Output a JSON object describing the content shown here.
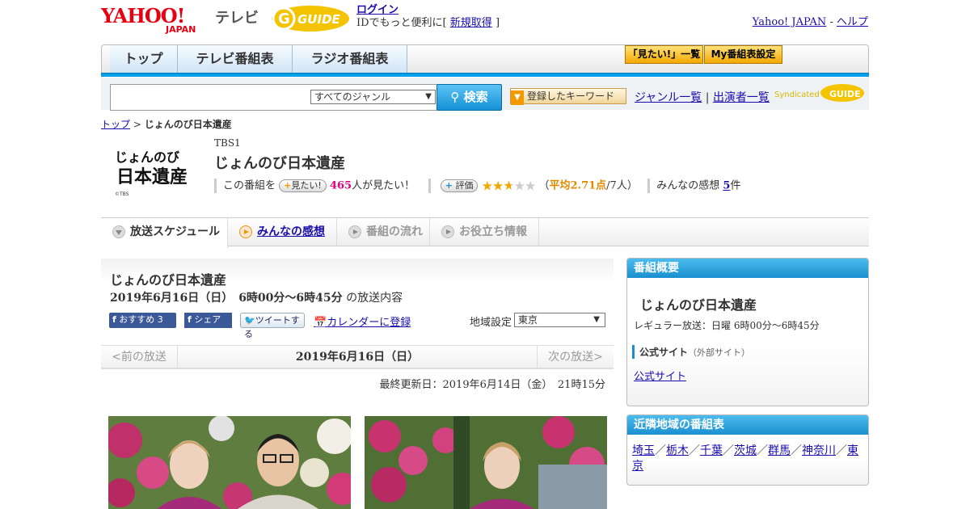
{
  "header": {
    "yahoo_logo": "YAHOO! JAPAN",
    "tv_label": "テレビ",
    "gguide_logo": "G GUIDE",
    "login_label": "ログイン",
    "login_sub_prefix": "IDでもっと便利に[",
    "register_label": "新規取得",
    "login_sub_suffix": "]",
    "yahoo_japan_link": "Yahoo! JAPAN",
    "dash": "-",
    "help_link": "ヘルプ"
  },
  "nav": {
    "tabs": [
      {
        "label": "トップ"
      },
      {
        "label": "テレビ番組表"
      },
      {
        "label": "ラジオ番組表"
      }
    ],
    "mitai_list": "「見たい!」一覧",
    "my_schedule": "My番組表設定"
  },
  "search": {
    "genre_selected": "すべてのジャンル",
    "search_button": "検索",
    "keyword_button": "登録したキーワード",
    "genre_list_link": "ジャンル一覧",
    "link_sep": "|",
    "performer_list_link": "出演者一覧",
    "syndicated": "Syndicated"
  },
  "breadcrumb": {
    "top": "トップ",
    "sep": ">",
    "current": "じょんのび日本遺産"
  },
  "program": {
    "logo_text": "じょんのび日本遺産",
    "logo_credit": "©TBS",
    "channel": "TBS1",
    "title": "じょんのび日本遺産",
    "mitai_prefix": "この番組を",
    "mitai_button": "見たい!",
    "mitai_count": "465",
    "mitai_suffix": "人が見たい！",
    "rating_button": "評価",
    "rating_value": 2.71,
    "rating_open": "（",
    "rating_avg_label": "平均2.71点",
    "rating_count": "/7人）",
    "impressions_label": "みんなの感想",
    "impressions_count": "5",
    "impressions_suffix": "件"
  },
  "program_tabs": [
    {
      "label": "放送スケジュール"
    },
    {
      "label": "みんなの感想"
    },
    {
      "label": "番組の流れ"
    },
    {
      "label": "お役立ち情報"
    }
  ],
  "main": {
    "title": "じょんのび日本遺産",
    "air_datetime": "2019年6月16日（日）　6時00分～6時45分",
    "air_suffix": "の放送内容",
    "recommend_button": "おすすめ 3",
    "share_button": "シェア",
    "tweet_button": "ツイートする",
    "calendar_link": "カレンダーに登録",
    "region_label": "地域設定",
    "region_selected": "東京",
    "prev_label": "<前の放送",
    "current_date": "2019年6月16日（日）",
    "next_label": "次の放送>",
    "updated": "最終更新日：2019年6月14日（金）　21時15分"
  },
  "sidebar": {
    "overview_title": "番組概要",
    "program_title": "じょんのび日本遺産",
    "regular": "レギュラー放送：日曜 6時00分～6時45分",
    "official_site_label": "公式サイト",
    "official_site_note": "（外部サイト）",
    "official_site_link": "公式サイト",
    "nearby_title": "近隣地域の番組表",
    "areas": [
      "埼玉",
      "栃木",
      "千葉",
      "茨城",
      "群馬",
      "神奈川",
      "東京"
    ],
    "area_sep": "／"
  },
  "colors": {
    "accent_blue": "#00a0e9",
    "pink": "#e4007f",
    "orange": "#e08a00",
    "link": "#1a0dab"
  }
}
